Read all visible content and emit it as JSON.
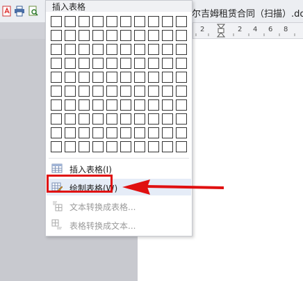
{
  "document_title": "尔吉姆租赁合同（扫描）.docx",
  "ruler": {
    "labels": [
      "2",
      "2",
      "4",
      "6",
      "8"
    ]
  },
  "insert_table_menu": {
    "header": "插入表格",
    "grid": {
      "rows": 10,
      "cols": 10
    },
    "items": [
      {
        "label": "插入表格(I)",
        "icon": "table-icon",
        "state": "normal"
      },
      {
        "label": "绘制表格(W)",
        "icon": "draw-table-icon",
        "state": "hover"
      },
      {
        "label": "文本转换成表格...",
        "icon": "text-to-table-icon",
        "state": "disabled"
      },
      {
        "label": "表格转换成文本...",
        "icon": "table-to-text-icon",
        "state": "disabled"
      }
    ]
  },
  "toolbar_icons": [
    "pdf-export-icon",
    "print-icon",
    "print-preview-icon"
  ],
  "colors": {
    "highlight_red": "#e01010",
    "hover_bg": "#e5ecf7",
    "disabled_text": "#9a9a9a"
  }
}
